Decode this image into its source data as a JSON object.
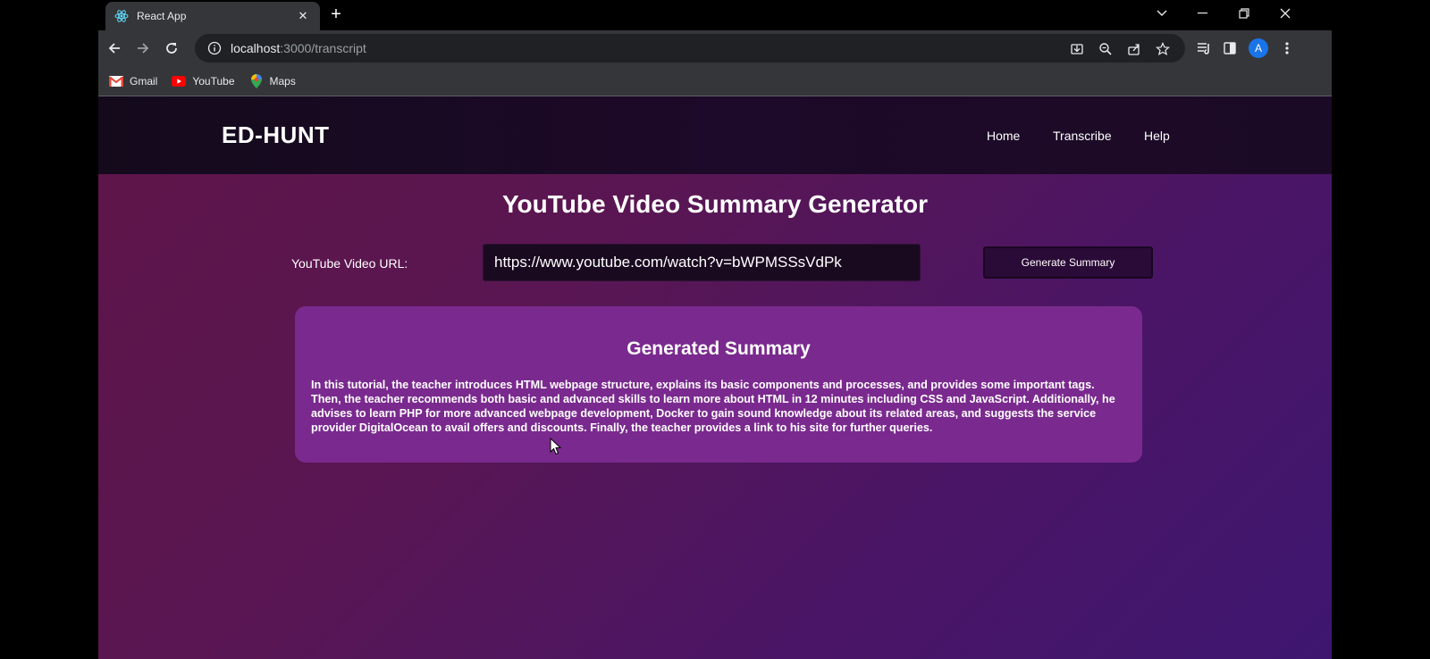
{
  "browser": {
    "tab": {
      "title": "React App",
      "favicon": "react-icon",
      "close_glyph": "✕"
    },
    "new_tab_glyph": "+",
    "window_controls": {
      "dropdown": "⌄",
      "minimize": "—",
      "restore": "❐",
      "close": "✕"
    },
    "url": {
      "host": "localhost",
      "path": ":3000/transcript"
    },
    "avatar_letter": "A",
    "bookmarks": [
      {
        "label": "Gmail",
        "icon": "gmail-icon"
      },
      {
        "label": "YouTube",
        "icon": "youtube-icon"
      },
      {
        "label": "Maps",
        "icon": "maps-icon"
      }
    ]
  },
  "navbar": {
    "brand": "ED-HUNT",
    "links": [
      "Home",
      "Transcribe",
      "Help"
    ]
  },
  "main": {
    "title": "YouTube Video Summary Generator",
    "url_label": "YouTube Video URL:",
    "url_value": "https://www.youtube.com/watch?v=bWPMSSsVdPk",
    "generate_button": "Generate Summary"
  },
  "summary": {
    "title": "Generated Summary",
    "text": "In this tutorial, the teacher introduces HTML webpage structure, explains its basic components and processes, and provides some important tags. Then, the teacher recommends both basic and advanced skills to learn more about HTML in 12 minutes including CSS and JavaScript. Additionally, he advises to learn PHP for more advanced webpage development, Docker to gain sound knowledge about its related areas, and suggests the service provider DigitalOcean to avail offers and discounts. Finally, the teacher provides a link to his site for further queries."
  },
  "colors": {
    "page_gradient_start": "#5e1548",
    "page_gradient_end": "#3e1670",
    "navbar_bg": "#1b0a26",
    "card_bg": "#7a2a8e"
  }
}
